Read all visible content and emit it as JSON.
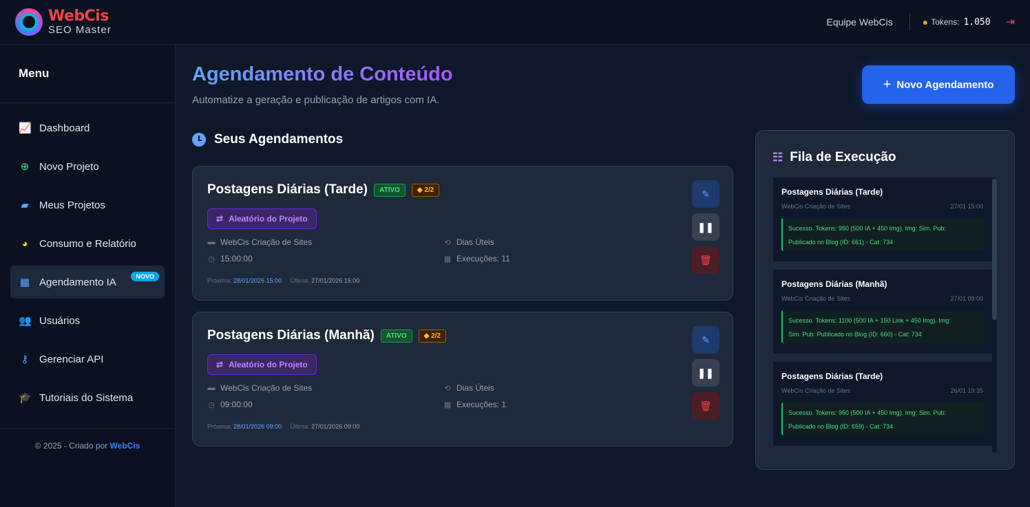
{
  "brand": {
    "name": "WebCis",
    "subtitle": "SEO Master"
  },
  "header": {
    "team": "Equipe WebCis",
    "tokens_label": "Tokens:",
    "tokens_value": "1.050",
    "icons": {
      "tokens": "coins-icon",
      "logout": "logout-icon"
    }
  },
  "sidebar": {
    "title": "Menu",
    "items": [
      {
        "label": "Dashboard",
        "icon": "chart-line-icon",
        "color": "#60a5fa"
      },
      {
        "label": "Novo Projeto",
        "icon": "plus-circle-icon",
        "color": "#4ade80"
      },
      {
        "label": "Meus Projetos",
        "icon": "folder-open-icon",
        "color": "#60a5fa"
      },
      {
        "label": "Consumo e Relatório",
        "icon": "chart-pie-icon",
        "color": "#facc15"
      },
      {
        "label": "Agendamento IA",
        "icon": "calendar-icon",
        "color": "#60a5fa",
        "badge": "NOVO",
        "active": true
      },
      {
        "label": "Usuários",
        "icon": "users-icon",
        "color": "#a78bfa"
      },
      {
        "label": "Gerenciar API",
        "icon": "key-icon",
        "color": "#60a5fa"
      },
      {
        "label": "Tutoriais do Sistema",
        "icon": "graduation-cap-icon",
        "color": "#a78bfa"
      }
    ],
    "footer_prefix": "© 2025 - Criado por",
    "footer_link": "WebCis"
  },
  "page": {
    "title": "Agendamento de Conteúdo",
    "subtitle": "Automatize a geração e publicação de artigos com IA.",
    "new_button": "Novo Agendamento",
    "section_title": "Seus Agendamentos"
  },
  "schedules": [
    {
      "name": "Postagens Diárias (Tarde)",
      "status": "ATIVO",
      "count": "2/2",
      "mode": "Aleatório do Projeto",
      "project": "WebCis Criação de Sites",
      "time": "15:00:00",
      "frequency": "Dias Úteis",
      "executions": "Execuções: 11",
      "next_label": "Próxima:",
      "next_value": "28/01/2026 15:00",
      "last_label": "Última:",
      "last_value": "27/01/2026 15:00"
    },
    {
      "name": "Postagens Diárias (Manhã)",
      "status": "ATIVO",
      "count": "2/2",
      "mode": "Aleatório do Projeto",
      "project": "WebCis Criação de Sites",
      "time": "09:00:00",
      "frequency": "Dias Úteis",
      "executions": "Execuções: 1",
      "next_label": "Próxima:",
      "next_value": "28/01/2026 09:00",
      "last_label": "Última:",
      "last_value": "27/01/2026 09:00"
    }
  ],
  "queue": {
    "title": "Fila de Execução",
    "items": [
      {
        "name": "Postagens Diárias (Tarde)",
        "project": "WebCis Criação de Sites",
        "time": "27/01 15:00",
        "line1": "Sucesso. Tokens: 950 (500 IA + 450 Img). Img: Sim. Pub:",
        "line2": "Publicado no Blog (ID: 661) - Cat: 734"
      },
      {
        "name": "Postagens Diárias (Manhã)",
        "project": "WebCis Criação de Sites",
        "time": "27/01 09:00",
        "line1": "Sucesso. Tokens: 1100 (500 IA + 150 Link + 450 Img). Img:",
        "line2": "Sim. Pub: Publicado no Blog (ID: 660) - Cat: 734"
      },
      {
        "name": "Postagens Diárias (Tarde)",
        "project": "WebCis Criação de Sites",
        "time": "26/01 19:35",
        "line1": "Sucesso. Tokens: 950 (500 IA + 450 Img). Img: Sim. Pub:",
        "line2": "Publicado no Blog (ID: 659) - Cat: 734"
      }
    ]
  }
}
